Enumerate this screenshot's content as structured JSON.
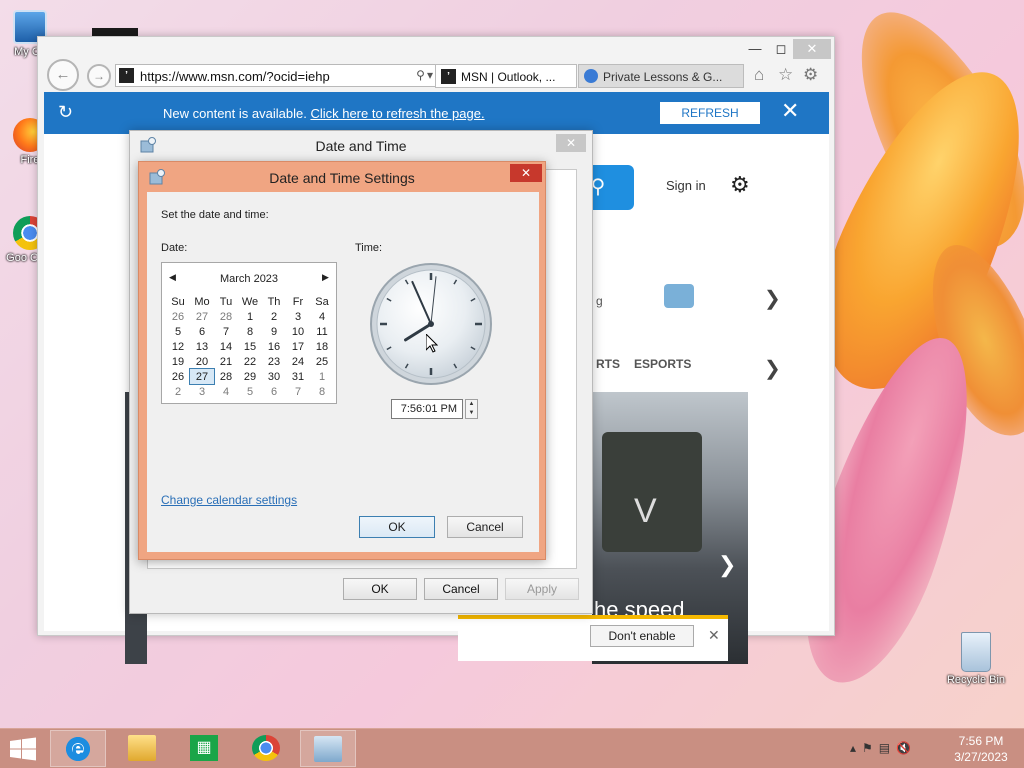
{
  "desktop": {
    "icons": [
      {
        "label": "My Co"
      },
      {
        "label": "Fire"
      },
      {
        "label": "Goo Chro"
      },
      {
        "label": "Recycle Bin"
      }
    ]
  },
  "browser": {
    "url": "https://www.msn.com/?ocid=iehp",
    "tabs": [
      {
        "label": "MSN | Outlook, ..."
      },
      {
        "label": "Private Lessons & G..."
      }
    ],
    "notification": {
      "message": "New content is available.",
      "link": "Click here to refresh the page.",
      "button": "REFRESH"
    },
    "msn": {
      "sign_in": "Sign in",
      "nav_partial": "g",
      "nav_sports": "RTS",
      "nav_esports": "ESPORTS",
      "hero_letter": "V",
      "hero_caption": "he speed",
      "cookie_button": "Don't enable"
    }
  },
  "date_time_dialog": {
    "title": "Date and Time",
    "buttons": {
      "ok": "OK",
      "cancel": "Cancel",
      "apply": "Apply"
    }
  },
  "settings_dialog": {
    "title": "Date and Time Settings",
    "instruction": "Set the date and time:",
    "date_label": "Date:",
    "time_label": "Time:",
    "calendar": {
      "month": "March 2023",
      "weekdays": [
        "Su",
        "Mo",
        "Tu",
        "We",
        "Th",
        "Fr",
        "Sa"
      ],
      "weeks": [
        [
          "26",
          "27",
          "28",
          "1",
          "2",
          "3",
          "4"
        ],
        [
          "5",
          "6",
          "7",
          "8",
          "9",
          "10",
          "11"
        ],
        [
          "12",
          "13",
          "14",
          "15",
          "16",
          "17",
          "18"
        ],
        [
          "19",
          "20",
          "21",
          "22",
          "23",
          "24",
          "25"
        ],
        [
          "26",
          "27",
          "28",
          "29",
          "30",
          "31",
          "1"
        ],
        [
          "2",
          "3",
          "4",
          "5",
          "6",
          "7",
          "8"
        ]
      ],
      "selected": "27"
    },
    "clock": {
      "hours": 7,
      "minutes": 56,
      "seconds": 1
    },
    "time_value": "7:56:01 PM",
    "change_calendar_link": "Change calendar settings",
    "buttons": {
      "ok": "OK",
      "cancel": "Cancel"
    }
  },
  "taskbar": {
    "clock_time": "7:56 PM",
    "clock_date": "3/27/2023"
  },
  "colors": {
    "settings_frame": "#f0a582",
    "notification_bar": "#1f76c5",
    "taskbar": "#c98f82"
  }
}
